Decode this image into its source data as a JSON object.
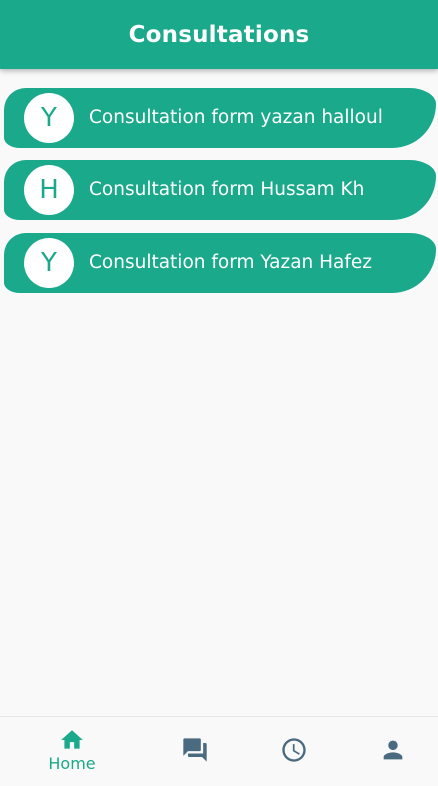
{
  "app_bar": {
    "title": "Consultations"
  },
  "consultations": [
    {
      "initial": "Y",
      "label": "Consultation form yazan halloul"
    },
    {
      "initial": "H",
      "label": "Consultation form Hussam Kh"
    },
    {
      "initial": "Y",
      "label": "Consultation form Yazan Hafez"
    }
  ],
  "bottom_nav": {
    "items": [
      {
        "label": "Home",
        "icon": "home-icon",
        "active": true
      },
      {
        "icon": "chat-icon"
      },
      {
        "icon": "clock-icon"
      },
      {
        "icon": "person-icon"
      }
    ]
  },
  "colors": {
    "primary": "#1aa98b",
    "icon_inactive": "#4a6a80",
    "background": "#f9f9f9"
  }
}
